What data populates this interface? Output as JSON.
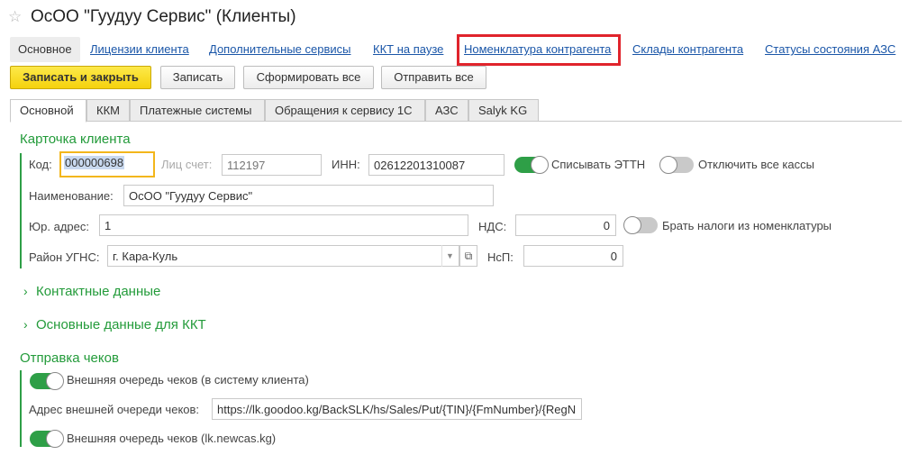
{
  "window": {
    "title": "ОсОО \"Гуудуу Сервис\" (Клиенты)"
  },
  "nav": {
    "tabs": [
      {
        "label": "Основное"
      },
      {
        "label": "Лицензии клиента"
      },
      {
        "label": "Дополнительные сервисы"
      },
      {
        "label": "ККТ на паузе"
      },
      {
        "label": "Номенклатура контрагента"
      },
      {
        "label": "Склады контрагента"
      },
      {
        "label": "Статусы состояния АЗС"
      }
    ]
  },
  "toolbar": {
    "save_close": "Записать и закрыть",
    "save": "Записать",
    "form_all": "Сформировать все",
    "send_all": "Отправить все"
  },
  "form_tabs": [
    {
      "label": "Основной"
    },
    {
      "label": "ККМ"
    },
    {
      "label": "Платежные системы"
    },
    {
      "label": "Обращения к сервису 1С"
    },
    {
      "label": "АЗС"
    },
    {
      "label": "Salyk KG"
    }
  ],
  "card": {
    "title": "Карточка клиента",
    "code_label": "Код:",
    "code_value": "000000698",
    "account_label": "Лиц счет:",
    "account_value": "112197",
    "inn_label": "ИНН:",
    "inn_value": "02612201310087",
    "ettn_label": "Списывать ЭТТН",
    "ettn_on": true,
    "disable_kassy_label": "Отключить все кассы",
    "disable_kassy_on": false,
    "name_label": "Наименование:",
    "name_value": "ОсОО \"Гуудуу Сервис\"",
    "address_label": "Юр. адрес:",
    "address_value": "1",
    "nds_label": "НДС:",
    "nds_value": "0",
    "taxes_label": "Брать налоги из номенклатуры",
    "taxes_on": false,
    "ugns_label": "Район УГНС:",
    "ugns_value": "г. Кара-Куль",
    "nsp_label": "НсП:",
    "nsp_value": "0"
  },
  "sections": {
    "contacts": "Контактные данные",
    "kkt_data": "Основные данные для ККТ"
  },
  "checks": {
    "title": "Отправка чеков",
    "ext_queue_label": "Внешняя очередь чеков (в систему клиента)",
    "ext_queue_on": true,
    "ext_address_label": "Адрес внешней очереди чеков:",
    "ext_address_value": "https://lk.goodoo.kg/BackSLK/hs/Sales/Put/{TIN}/{FmNumber}/{RegN",
    "newcas_label": "Внешняя очередь чеков (lk.newcas.kg)",
    "newcas_on": true
  },
  "colors": {
    "accent_green": "#2e9f47",
    "primary_button": "#f5d20d",
    "highlight_red": "#e0242c",
    "link_blue": "#1a56a8"
  }
}
